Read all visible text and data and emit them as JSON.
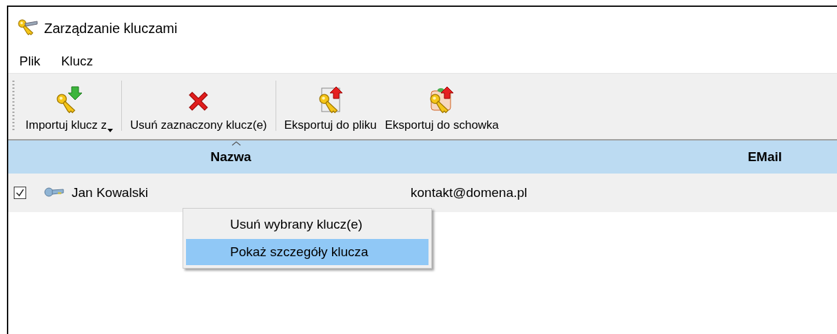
{
  "window": {
    "title": "Zarządzanie kluczami"
  },
  "menu": [
    "Plik",
    "Klucz"
  ],
  "toolbar": [
    {
      "kind": "import",
      "label": "Importuj klucz z",
      "dropdown": true
    },
    {
      "kind": "separator"
    },
    {
      "kind": "delete",
      "label": "Usuń zaznaczony klucz(e)",
      "dropdown": false
    },
    {
      "kind": "separator"
    },
    {
      "kind": "export-file",
      "label": "Eksportuj do pliku",
      "dropdown": false
    },
    {
      "kind": "export-clipboard",
      "label": "Eksportuj do schowka",
      "dropdown": false
    }
  ],
  "table": {
    "columns": [
      {
        "label": "Nazwa",
        "sorted": true
      },
      {
        "label": "EMail",
        "sorted": false
      }
    ],
    "rows": [
      {
        "checked": true,
        "name": "Jan Kowalski",
        "email": "kontakt@domena.pl"
      }
    ]
  },
  "context_menu": [
    {
      "label": "Usuń wybrany klucz(e)",
      "selected": false
    },
    {
      "label": "Pokaż szczegóły klucza",
      "selected": true
    }
  ]
}
